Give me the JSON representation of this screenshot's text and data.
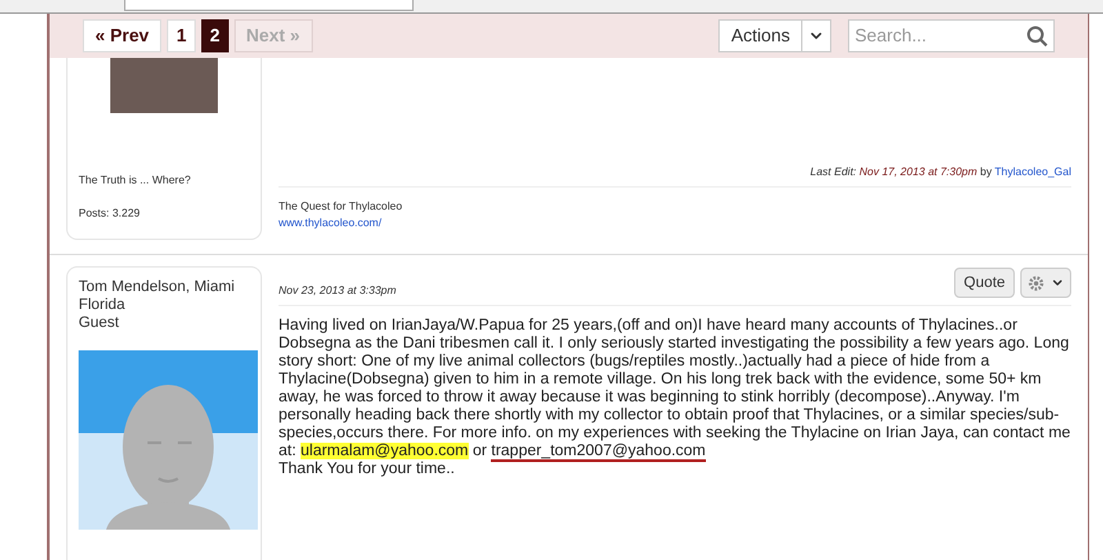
{
  "pagination": {
    "prev": "« Prev",
    "pages": [
      {
        "label": "1",
        "selected": false
      },
      {
        "label": "2",
        "selected": true
      }
    ],
    "next": "Next »",
    "next_disabled": true
  },
  "toolbar": {
    "actions": "Actions",
    "search_placeholder": "Search..."
  },
  "posts": [
    {
      "author": {
        "signature_line": "The Truth is ... Where?",
        "posts": "Posts: 3.229",
        "avatar": {
          "kind": "photo"
        }
      },
      "last_edit": {
        "label": "Last Edit:",
        "date": "Nov 17, 2013 at 7:30pm",
        "by": "by",
        "user": "Thylacoleo_Gal"
      },
      "signature": {
        "text": "The Quest for Thylacoleo",
        "link": "www.thylacoleo.com/"
      }
    },
    {
      "author": {
        "name": "Tom Mendelson, Miami Florida",
        "role": "Guest",
        "avatar": {
          "kind": "silhouette"
        }
      },
      "date": "Nov 23, 2013 at 3:33pm",
      "quote": "Quote",
      "body": {
        "text": "Having lived on IrianJaya/W.Papua for 25 years,(off and on)I have heard many accounts of Thylacines..or Dobsegna as the Dani tribesmen call it. I only seriously started investigating the possibility a few years ago. Long story short: One of my live animal collectors (bugs/reptiles mostly..)actually had a piece of hide from a Thylacine(Dobsegna) given to him in a remote village. On his long trek back with the evidence, some 50+ km away, he was forced to throw it away because it was beginning to stink horribly (decompose)..Anyway. I'm personally heading back there shortly with my collector to obtain proof that Thylacines, or a similar species/sub-species,occurs there. For more info. on my experiences with seeking the Thylacine on Irian Jaya, can contact me at:",
        "email_1": "ularmalam@yahoo.com",
        "separator": "or",
        "email_2": "trapper_tom2007@yahoo.com",
        "closing": "Thank You for your time.."
      }
    }
  ]
}
